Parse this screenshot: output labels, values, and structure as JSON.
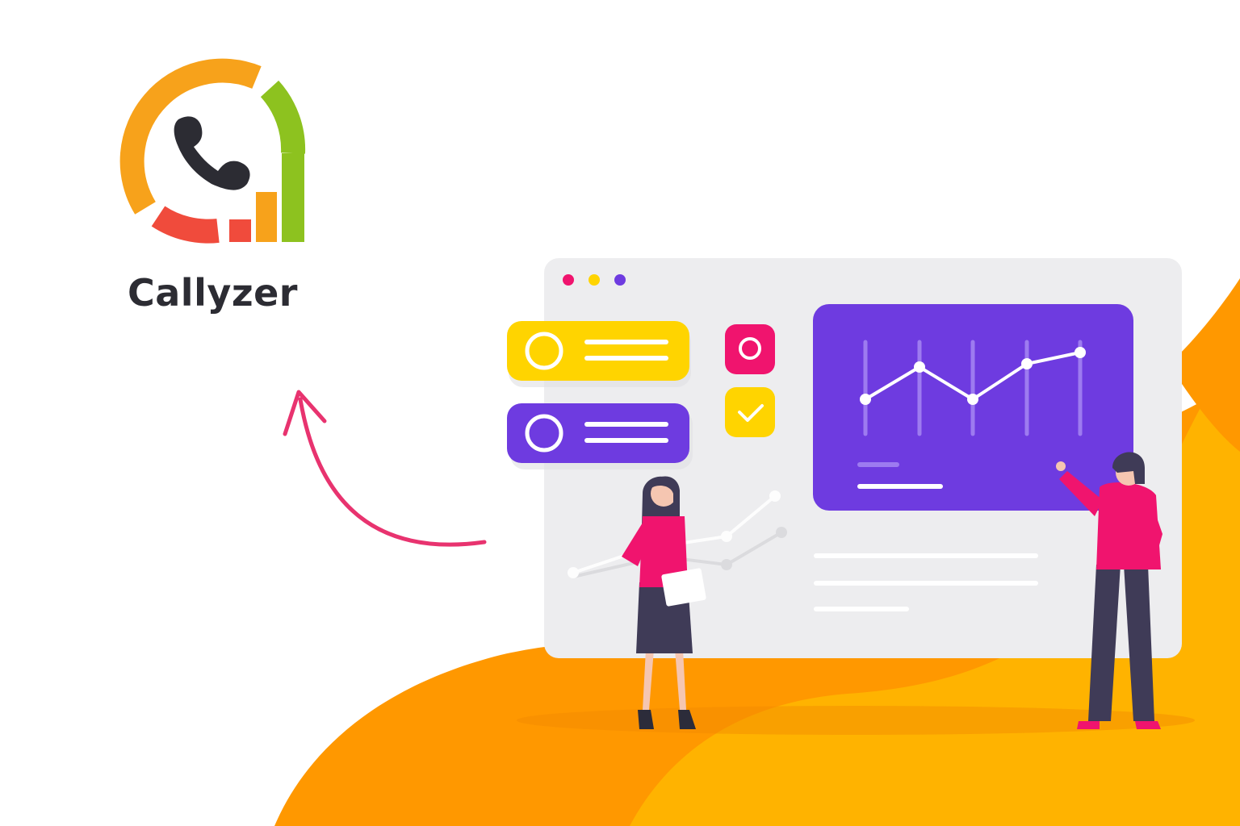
{
  "brand": {
    "name": "Callyzer",
    "logo_icon": "phone-analytics-logo"
  },
  "colors": {
    "background": "#ffffff",
    "brand_text": "#2c2c33",
    "logo_orange": "#F7A21B",
    "logo_green": "#8DC21F",
    "logo_red": "#F04B3C",
    "phone": "#2c2c33",
    "accent_purple": "#6E3BE0",
    "accent_yellow": "#FFD400",
    "accent_pink": "#F0146E",
    "blob_orange": "#FF9800",
    "blob_amber": "#FFB300",
    "panel_gray": "#EDEDEF",
    "arrow": "#E8336F"
  },
  "illustration": {
    "window_dots": [
      "pink",
      "yellow",
      "purple"
    ],
    "icons": [
      "radio-icon",
      "check-icon",
      "line-chart-icon"
    ],
    "figures": [
      "woman-with-clipboard",
      "man-pointing"
    ]
  }
}
